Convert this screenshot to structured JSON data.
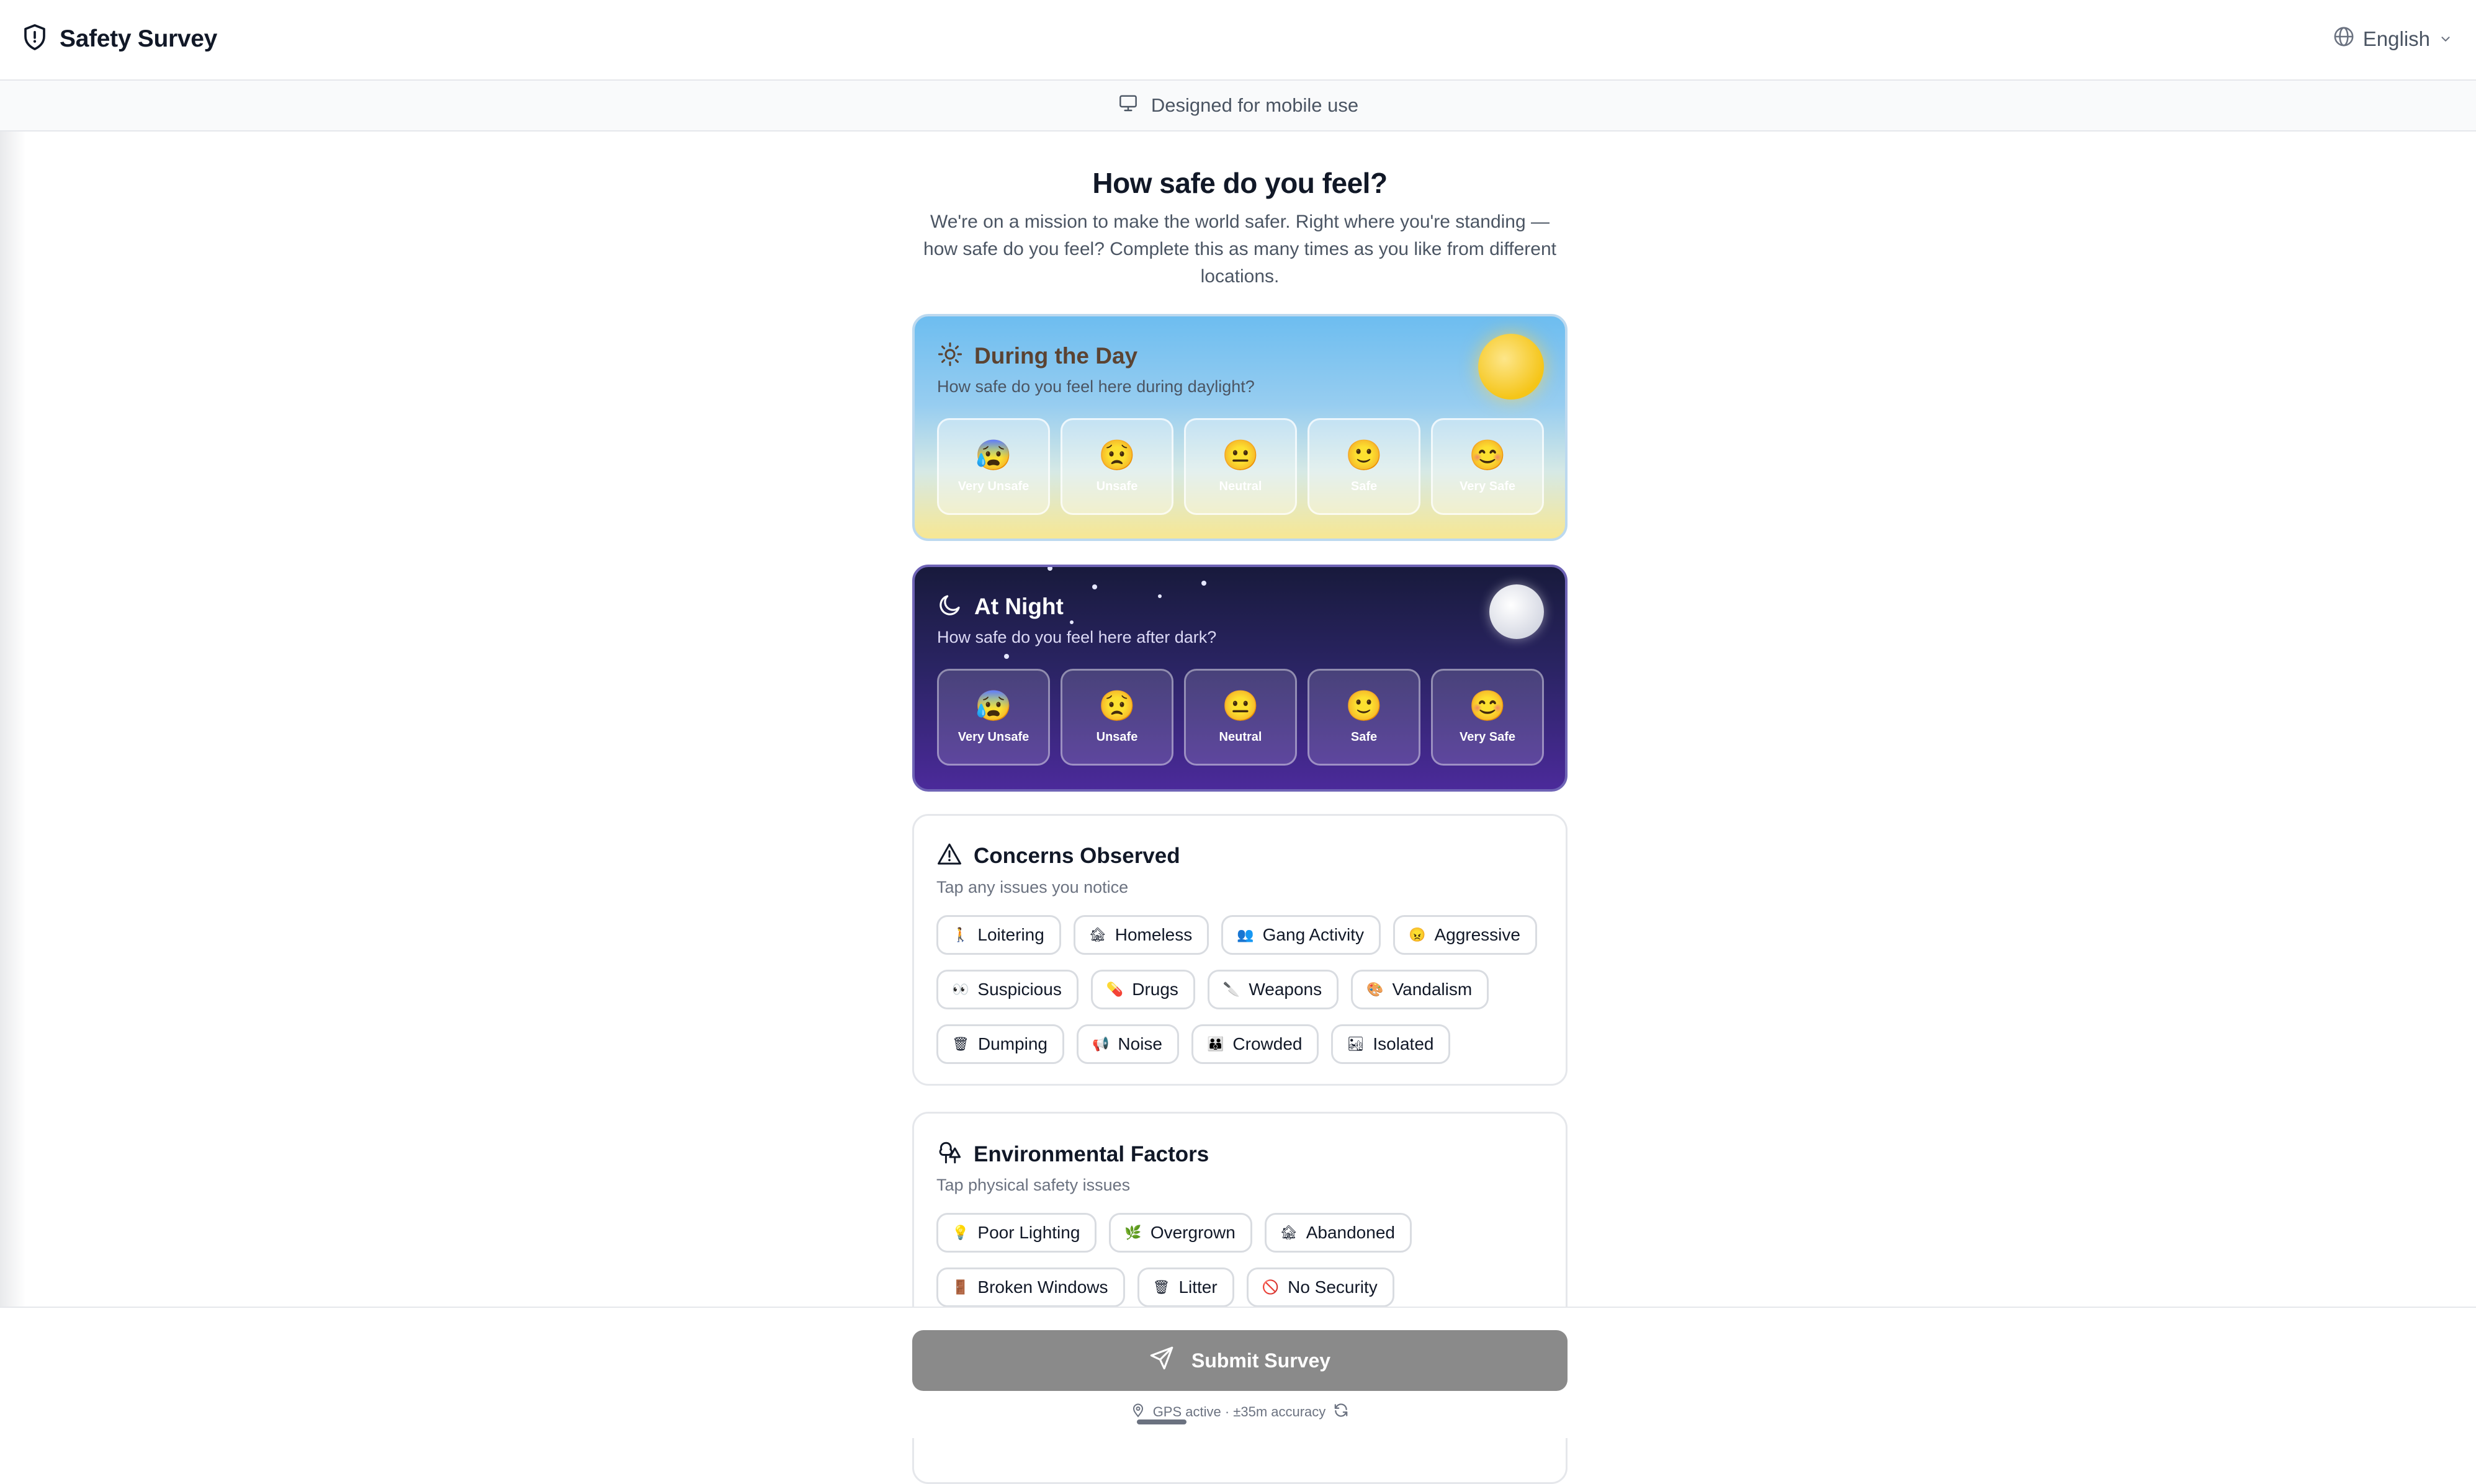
{
  "header": {
    "title": "Safety Survey",
    "language": "English"
  },
  "banner": {
    "text": "Designed for mobile use"
  },
  "intro": {
    "title": "How safe do you feel?",
    "description": "We're on a mission to make the world safer. Right where you're standing — how safe do you feel? Complete this as many times as you like from different locations."
  },
  "day": {
    "title": "During the Day",
    "subtitle": "How safe do you feel here during daylight?",
    "options": [
      {
        "emoji": "😰",
        "label": "Very Unsafe"
      },
      {
        "emoji": "😟",
        "label": "Unsafe"
      },
      {
        "emoji": "😐",
        "label": "Neutral"
      },
      {
        "emoji": "🙂",
        "label": "Safe"
      },
      {
        "emoji": "😊",
        "label": "Very Safe"
      }
    ]
  },
  "night": {
    "title": "At Night",
    "subtitle": "How safe do you feel here after dark?",
    "options": [
      {
        "emoji": "😰",
        "label": "Very Unsafe"
      },
      {
        "emoji": "😟",
        "label": "Unsafe"
      },
      {
        "emoji": "😐",
        "label": "Neutral"
      },
      {
        "emoji": "🙂",
        "label": "Safe"
      },
      {
        "emoji": "😊",
        "label": "Very Safe"
      }
    ]
  },
  "concerns": {
    "title": "Concerns Observed",
    "subtitle": "Tap any issues you notice",
    "chips": [
      {
        "icon": "🚶",
        "label": "Loitering"
      },
      {
        "icon": "🏚",
        "label": "Homeless"
      },
      {
        "icon": "👥",
        "label": "Gang Activity"
      },
      {
        "icon": "😠",
        "label": "Aggressive"
      },
      {
        "icon": "👀",
        "label": "Suspicious"
      },
      {
        "icon": "💊",
        "label": "Drugs"
      },
      {
        "icon": "🔪",
        "label": "Weapons"
      },
      {
        "icon": "🎨",
        "label": "Vandalism"
      },
      {
        "icon": "🗑",
        "label": "Dumping"
      },
      {
        "icon": "📢",
        "label": "Noise"
      },
      {
        "icon": "👪",
        "label": "Crowded"
      },
      {
        "icon": "🏜",
        "label": "Isolated"
      }
    ]
  },
  "environment": {
    "title": "Environmental Factors",
    "subtitle": "Tap physical safety issues",
    "chips": [
      {
        "icon": "💡",
        "label": "Poor Lighting"
      },
      {
        "icon": "🌿",
        "label": "Overgrown"
      },
      {
        "icon": "🏚",
        "label": "Abandoned"
      },
      {
        "icon": "🚪",
        "label": "Broken Windows"
      },
      {
        "icon": "🗑",
        "label": "Litter"
      },
      {
        "icon": "🚫",
        "label": "No Security"
      }
    ]
  },
  "footer": {
    "submit_label": "Submit Survey",
    "gps_status": "GPS active · ±35m accuracy"
  },
  "icons": {
    "brand": "shield-icon",
    "language": "globe-icon",
    "banner": "monitor-icon",
    "day": "sun-icon",
    "night": "moon-icon",
    "concerns": "warning-triangle-icon",
    "environment": "trees-icon",
    "submit": "send-icon",
    "gps": "map-pin-icon",
    "refresh": "refresh-icon"
  },
  "colors": {
    "submit_button": "#8a8a8a",
    "night_card": "#2a2463",
    "day_card": "#97cdf0"
  }
}
